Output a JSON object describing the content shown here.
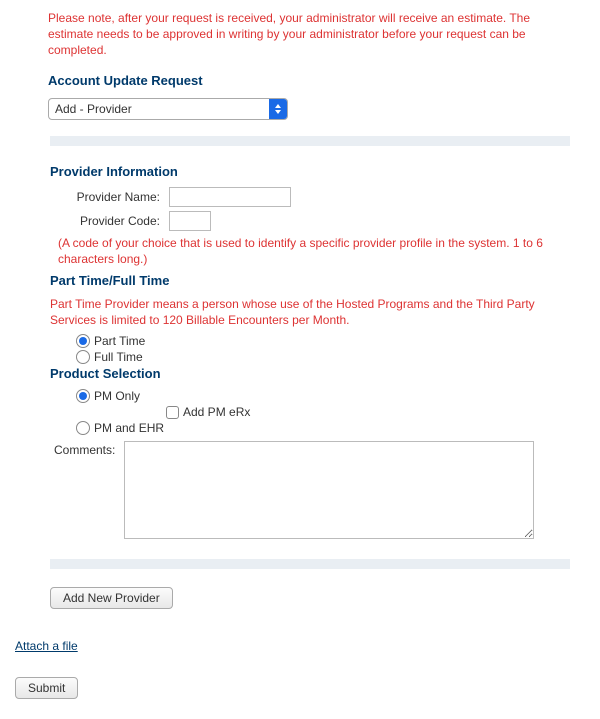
{
  "notice": "Please note, after your request is received, your administrator will receive an estimate. The estimate needs to be approved in writing by your administrator before your request can be completed.",
  "account_update_request": {
    "title": "Account Update Request",
    "selected": "Add - Provider"
  },
  "provider_info": {
    "title": "Provider Information",
    "name_label": "Provider Name:",
    "name_value": "",
    "code_label": "Provider Code:",
    "code_value": "",
    "code_help": "(A code of your choice that is used to identify a specific provider profile in the system. 1 to 6 characters long.)"
  },
  "employment": {
    "title": "Part Time/Full Time",
    "help": "Part Time Provider means a person whose use of the Hosted Programs and the Third Party Services is limited to 120 Billable Encounters per Month.",
    "part_time_label": "Part Time",
    "full_time_label": "Full Time",
    "selected": "part_time"
  },
  "product": {
    "title": "Product Selection",
    "pm_only_label": "PM Only",
    "add_pm_erx_label": "Add PM eRx",
    "pm_and_ehr_label": "PM and EHR",
    "selected": "pm_only",
    "add_pm_erx_checked": false
  },
  "comments": {
    "label": "Comments:",
    "value": ""
  },
  "buttons": {
    "add_new_provider": "Add New Provider",
    "submit": "Submit"
  },
  "links": {
    "attach_file": "Attach a file"
  }
}
